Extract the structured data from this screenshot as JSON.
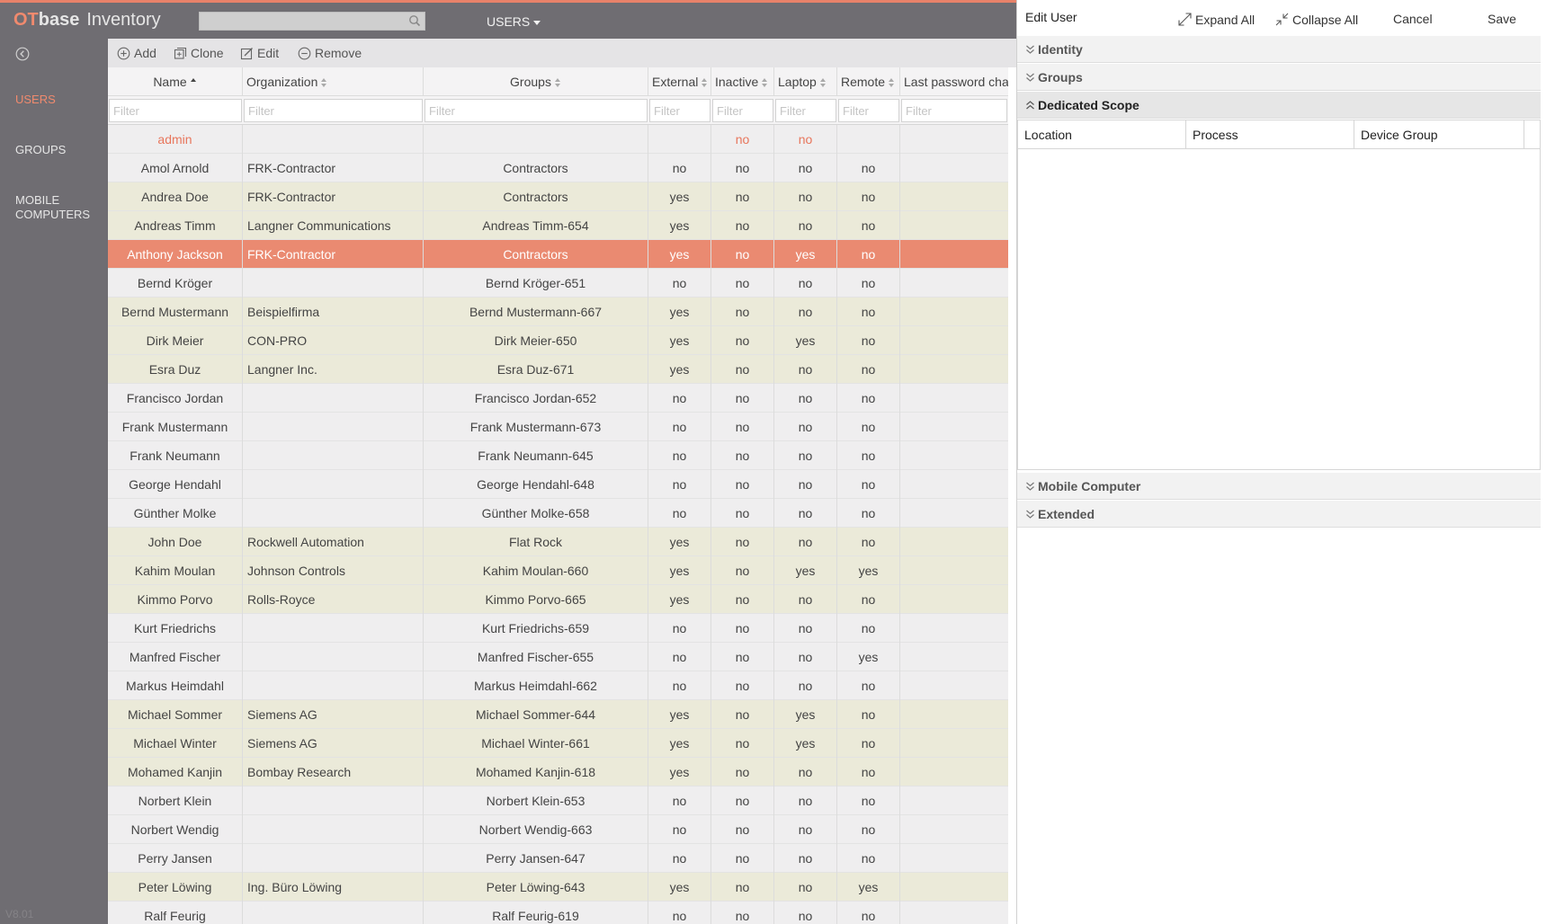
{
  "app": {
    "brand_ot": "OT",
    "brand_base": "base",
    "brand_product": "Inventory",
    "menu": "USERS",
    "version": "V8.01"
  },
  "colors": {
    "accent": "#e8826a",
    "selected_row": "#ea8a71",
    "external_row": "#ebead9",
    "sidebar": "#6f6d72"
  },
  "sidebar": {
    "items": [
      {
        "label": "USERS",
        "active": true
      },
      {
        "label": "GROUPS",
        "active": false
      },
      {
        "label": "MOBILE\nCOMPUTERS",
        "active": false
      }
    ]
  },
  "toolbar": {
    "add": "Add",
    "clone": "Clone",
    "edit": "Edit",
    "remove": "Remove"
  },
  "table": {
    "headers": [
      "Name",
      "Organization",
      "Groups",
      "External",
      "Inactive",
      "Laptop",
      "Remote",
      "Last password cha"
    ],
    "filter_placeholder": "Filter",
    "rows": [
      [
        "admin",
        "",
        "",
        "",
        "no",
        "no",
        "",
        ""
      ],
      [
        "Amol Arnold",
        "FRK-Contractor",
        "Contractors",
        "no",
        "no",
        "no",
        "no",
        ""
      ],
      [
        "Andrea Doe",
        "FRK-Contractor",
        "Contractors",
        "yes",
        "no",
        "no",
        "no",
        ""
      ],
      [
        "Andreas Timm",
        "Langner Communications",
        "Andreas Timm-654",
        "yes",
        "no",
        "no",
        "no",
        ""
      ],
      [
        "Anthony Jackson",
        "FRK-Contractor",
        "Contractors",
        "yes",
        "no",
        "yes",
        "no",
        ""
      ],
      [
        "Bernd Kröger",
        "",
        "Bernd Kröger-651",
        "no",
        "no",
        "no",
        "no",
        ""
      ],
      [
        "Bernd Mustermann",
        "Beispielfirma",
        "Bernd Mustermann-667",
        "yes",
        "no",
        "no",
        "no",
        ""
      ],
      [
        "Dirk Meier",
        "CON-PRO",
        "Dirk Meier-650",
        "yes",
        "no",
        "yes",
        "no",
        ""
      ],
      [
        "Esra Duz",
        "Langner Inc.",
        "Esra Duz-671",
        "yes",
        "no",
        "no",
        "no",
        ""
      ],
      [
        "Francisco Jordan",
        "",
        "Francisco Jordan-652",
        "no",
        "no",
        "no",
        "no",
        ""
      ],
      [
        "Frank Mustermann",
        "",
        "Frank Mustermann-673",
        "no",
        "no",
        "no",
        "no",
        ""
      ],
      [
        "Frank Neumann",
        "",
        "Frank Neumann-645",
        "no",
        "no",
        "no",
        "no",
        ""
      ],
      [
        "George Hendahl",
        "",
        "George Hendahl-648",
        "no",
        "no",
        "no",
        "no",
        ""
      ],
      [
        "Günther Molke",
        "",
        "Günther Molke-658",
        "no",
        "no",
        "no",
        "no",
        ""
      ],
      [
        "John Doe",
        "Rockwell Automation",
        "Flat Rock",
        "yes",
        "no",
        "no",
        "no",
        ""
      ],
      [
        "Kahim Moulan",
        "Johnson Controls",
        "Kahim Moulan-660",
        "yes",
        "no",
        "yes",
        "yes",
        ""
      ],
      [
        "Kimmo Porvo",
        "Rolls-Royce",
        "Kimmo Porvo-665",
        "yes",
        "no",
        "no",
        "no",
        ""
      ],
      [
        "Kurt Friedrichs",
        "",
        "Kurt Friedrichs-659",
        "no",
        "no",
        "no",
        "no",
        ""
      ],
      [
        "Manfred Fischer",
        "",
        "Manfred Fischer-655",
        "no",
        "no",
        "no",
        "yes",
        ""
      ],
      [
        "Markus Heimdahl",
        "",
        "Markus Heimdahl-662",
        "no",
        "no",
        "no",
        "no",
        ""
      ],
      [
        "Michael Sommer",
        "Siemens AG",
        "Michael Sommer-644",
        "yes",
        "no",
        "yes",
        "no",
        ""
      ],
      [
        "Michael Winter",
        "Siemens AG",
        "Michael Winter-661",
        "yes",
        "no",
        "yes",
        "no",
        ""
      ],
      [
        "Mohamed Kanjin",
        "Bombay Research",
        "Mohamed Kanjin-618",
        "yes",
        "no",
        "no",
        "no",
        ""
      ],
      [
        "Norbert Klein",
        "",
        "Norbert Klein-653",
        "no",
        "no",
        "no",
        "no",
        ""
      ],
      [
        "Norbert Wendig",
        "",
        "Norbert Wendig-663",
        "no",
        "no",
        "no",
        "no",
        ""
      ],
      [
        "Perry Jansen",
        "",
        "Perry Jansen-647",
        "no",
        "no",
        "no",
        "no",
        ""
      ],
      [
        "Peter Löwing",
        "Ing. Büro Löwing",
        "Peter Löwing-643",
        "yes",
        "no",
        "no",
        "yes",
        ""
      ],
      [
        "Ralf Feurig",
        "",
        "Ralf Feurig-619",
        "no",
        "no",
        "no",
        "no",
        ""
      ]
    ],
    "selected": "Anthony Jackson"
  },
  "panel": {
    "title": "Edit User",
    "expand_all": "Expand All",
    "collapse_all": "Collapse All",
    "cancel": "Cancel",
    "save": "Save",
    "sections": [
      "Identity",
      "Groups",
      "Dedicated Scope",
      "Mobile Computer",
      "Extended"
    ],
    "scope_columns": [
      "Location",
      "Process",
      "Device Group"
    ]
  }
}
